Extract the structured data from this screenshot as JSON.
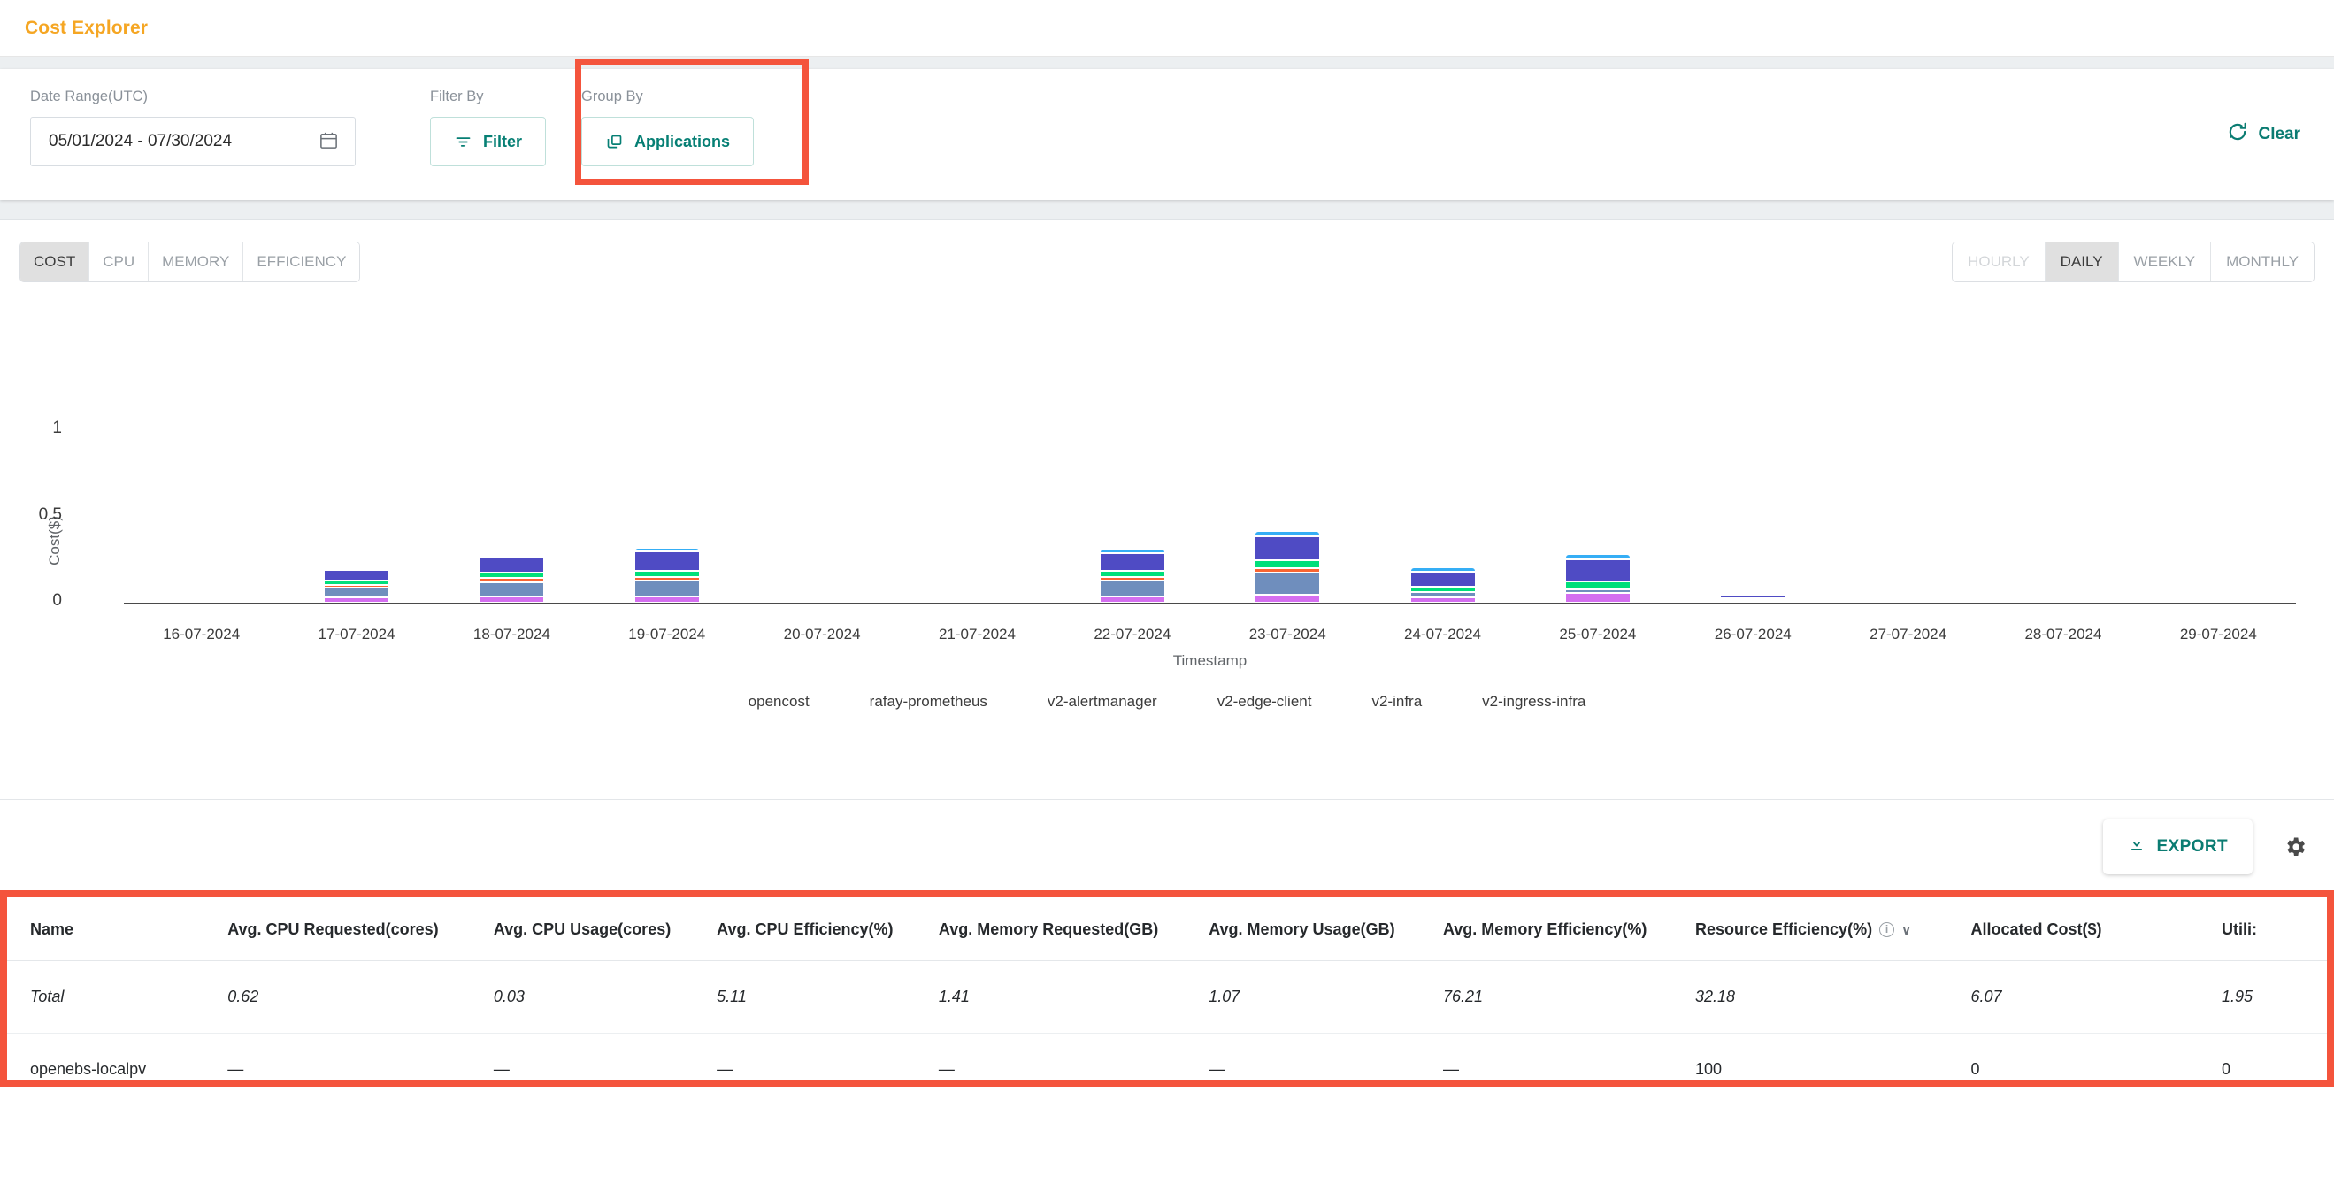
{
  "header": {
    "title": "Cost Explorer"
  },
  "filters": {
    "date_range": {
      "label": "Date Range(UTC)",
      "value": "05/01/2024  -  07/30/2024",
      "icon": "calendar-icon"
    },
    "filter_by": {
      "label": "Filter By",
      "button_label": "Filter",
      "icon": "filter-icon"
    },
    "group_by": {
      "label": "Group By",
      "button_label": "Applications",
      "icon": "copy-icon"
    },
    "clear": {
      "label": "Clear",
      "icon": "reset-icon"
    }
  },
  "chart_tabs": {
    "metrics": [
      {
        "label": "COST",
        "active": true
      },
      {
        "label": "CPU",
        "active": false
      },
      {
        "label": "MEMORY",
        "active": false
      },
      {
        "label": "EFFICIENCY",
        "active": false
      }
    ],
    "granularity": [
      {
        "label": "HOURLY",
        "active": false,
        "disabled": true
      },
      {
        "label": "DAILY",
        "active": true,
        "disabled": false
      },
      {
        "label": "WEEKLY",
        "active": false,
        "disabled": false
      },
      {
        "label": "MONTHLY",
        "active": false,
        "disabled": false
      }
    ]
  },
  "chart_data": {
    "type": "bar",
    "stacked": true,
    "title": "",
    "xlabel": "Timestamp",
    "ylabel": "Cost($)",
    "ylim": [
      0,
      1
    ],
    "yticks": [
      "0",
      "0.5",
      "1"
    ],
    "grid": false,
    "legend_position": "bottom",
    "categories": [
      "16-07-2024",
      "17-07-2024",
      "18-07-2024",
      "19-07-2024",
      "20-07-2024",
      "21-07-2024",
      "22-07-2024",
      "23-07-2024",
      "24-07-2024",
      "25-07-2024",
      "26-07-2024",
      "27-07-2024",
      "28-07-2024",
      "29-07-2024"
    ],
    "series": [
      {
        "name": "opencost",
        "color": "#d46ef0",
        "values": [
          0,
          0.032,
          0.035,
          0.038,
          0,
          0,
          0.038,
          0.047,
          0.033,
          0.054,
          0.01,
          0,
          0,
          0
        ]
      },
      {
        "name": "rafay-prometheus",
        "color": "#6f8ebd",
        "values": [
          0,
          0.055,
          0.085,
          0.09,
          0,
          0,
          0.092,
          0.125,
          0.028,
          0.022,
          0.004,
          0,
          0,
          0
        ]
      },
      {
        "name": "v2-alertmanager",
        "color": "#fa6432",
        "values": [
          0,
          0.018,
          0.022,
          0.022,
          0,
          0,
          0.02,
          0.027,
          0.0,
          0.0,
          0.003,
          0,
          0,
          0
        ]
      },
      {
        "name": "v2-edge-client",
        "color": "#00df7a",
        "values": [
          0,
          0.021,
          0.033,
          0.034,
          0,
          0,
          0.035,
          0.045,
          0.03,
          0.049,
          0.008,
          0,
          0,
          0
        ]
      },
      {
        "name": "v2-infra",
        "color": "#4f4bc4",
        "values": [
          0,
          0.062,
          0.084,
          0.112,
          0,
          0,
          0.103,
          0.14,
          0.089,
          0.125,
          0.023,
          0,
          0,
          0
        ]
      },
      {
        "name": "v2-ingress-infra",
        "color": "#35aef5",
        "values": [
          0,
          0.014,
          0.015,
          0.02,
          0,
          0,
          0.024,
          0.03,
          0.025,
          0.03,
          0.003,
          0,
          0,
          0
        ]
      }
    ]
  },
  "table": {
    "export_label": "EXPORT",
    "export_icon": "download-icon",
    "settings_icon": "gear-icon",
    "columns": [
      {
        "label": "Name"
      },
      {
        "label": "Avg. CPU Requested(cores)"
      },
      {
        "label": "Avg. CPU Usage(cores)"
      },
      {
        "label": "Avg. CPU Efficiency(%)"
      },
      {
        "label": "Avg. Memory Requested(GB)"
      },
      {
        "label": "Avg. Memory Usage(GB)"
      },
      {
        "label": "Avg. Memory Efficiency(%)"
      },
      {
        "label": "Resource Efficiency(%)",
        "info": true,
        "sort": "desc"
      },
      {
        "label": "Allocated Cost($)"
      },
      {
        "label": "Utili:"
      }
    ],
    "rows": [
      {
        "type": "total",
        "cells": [
          "Total",
          "0.62",
          "0.03",
          "5.11",
          "1.41",
          "1.07",
          "76.21",
          "32.18",
          "6.07",
          "1.95"
        ]
      },
      {
        "type": "data",
        "cells": [
          "openebs-localpv",
          "—",
          "—",
          "—",
          "—",
          "—",
          "—",
          "100",
          "0",
          "0"
        ]
      }
    ]
  },
  "highlights": {
    "accent_red": "#f4543c",
    "teal": "#0b7c72",
    "orange": "#f5a623"
  }
}
